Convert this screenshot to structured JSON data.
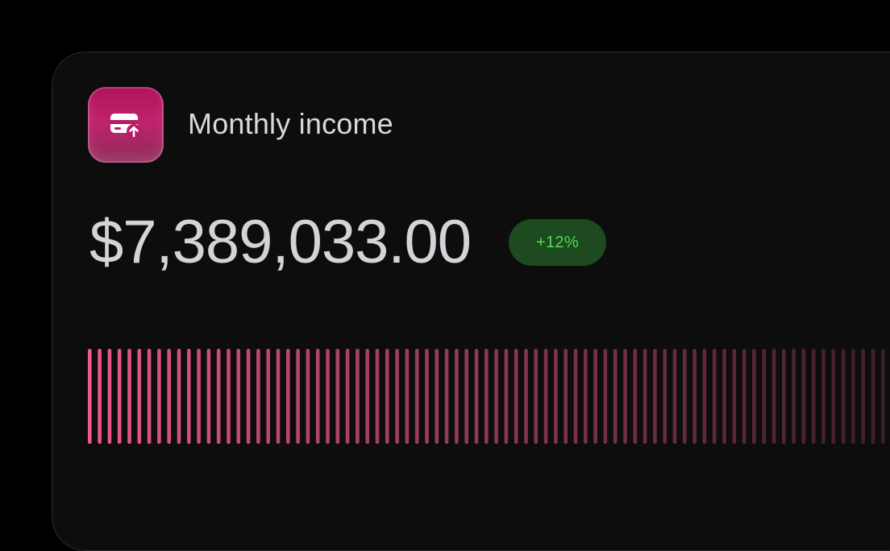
{
  "card": {
    "title": "Monthly income",
    "icon": "card-upload-icon",
    "amount": "$7,389,033.00",
    "change_badge": "+12%",
    "accent_color": "#c01c66",
    "bar_color": "#f0598a",
    "badge_bg": "#1d4a1f",
    "badge_text_color": "#4fdb57"
  }
}
